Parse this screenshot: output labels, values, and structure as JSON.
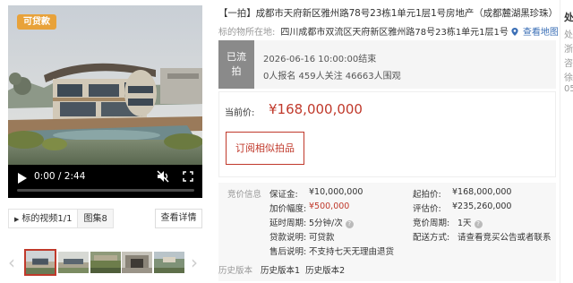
{
  "media": {
    "badge": "可贷款",
    "video": {
      "time": "0:00 / 2:44",
      "progress": 0
    },
    "tabs": [
      {
        "label": "标的视频1/1",
        "active": true
      },
      {
        "label": "图集8",
        "active": false
      }
    ],
    "detail_button": "查看详情",
    "thumb_count": 5,
    "active_thumb": 1
  },
  "lot": {
    "title": "【一拍】成都市天府新区雅州路78号23栋1单元1层1号房地产（成都麓湖黑珍珠）",
    "location_label": "标的物所在地:",
    "location": "四川成都市双流区天府新区雅州路78号23栋1单元1层1号",
    "map_link": "查看地图"
  },
  "status": {
    "tag": "已流拍",
    "tag_lines": [
      "已流",
      "拍"
    ],
    "end_time": "2026-06-16 10:00:00结束",
    "stats": "0人报名 459人关注 46663人围观"
  },
  "price": {
    "label": "当前价:",
    "value": "¥168,000,000",
    "subscribe_button": "订阅相似拍品"
  },
  "auction_info": {
    "heading": "竞价信息",
    "left": [
      {
        "label": "保证金:",
        "value": "¥10,000,000",
        "red": false,
        "help": false
      },
      {
        "label": "加价幅度:",
        "value": "¥500,000",
        "red": true,
        "help": false
      },
      {
        "label": "延时周期:",
        "value": "5分钟/次",
        "red": false,
        "help": true
      },
      {
        "label": "贷款说明:",
        "value": "可贷款",
        "red": false,
        "help": false
      },
      {
        "label": "售后说明:",
        "value": "不支持七天无理由退货",
        "red": false,
        "help": false
      }
    ],
    "right": [
      {
        "label": "起拍价:",
        "value": "¥168,000,000",
        "help": false
      },
      {
        "label": "评估价:",
        "value": "¥235,260,000",
        "help": false
      },
      {
        "label": "竞价周期:",
        "value": "1天",
        "help": true
      },
      {
        "label": "配送方式:",
        "value": "请查看竞买公告或者联系",
        "help": false
      }
    ]
  },
  "history": {
    "label": "历史版本",
    "links": [
      "历史版本1",
      "历史版本2"
    ]
  },
  "side_panel": {
    "title": "处",
    "lines": [
      "处",
      "浙",
      "咨",
      "徐",
      "05"
    ]
  },
  "colors": {
    "accent_red": "#c0392b",
    "badge_orange": "#e8a23a",
    "status_gray": "#8a8a8a",
    "link_blue": "#3b6fb6"
  },
  "icons": [
    "play-icon",
    "mute-icon",
    "fullscreen-icon",
    "location-pin-icon",
    "chevron-left-icon",
    "chevron-right-icon",
    "help-icon"
  ]
}
